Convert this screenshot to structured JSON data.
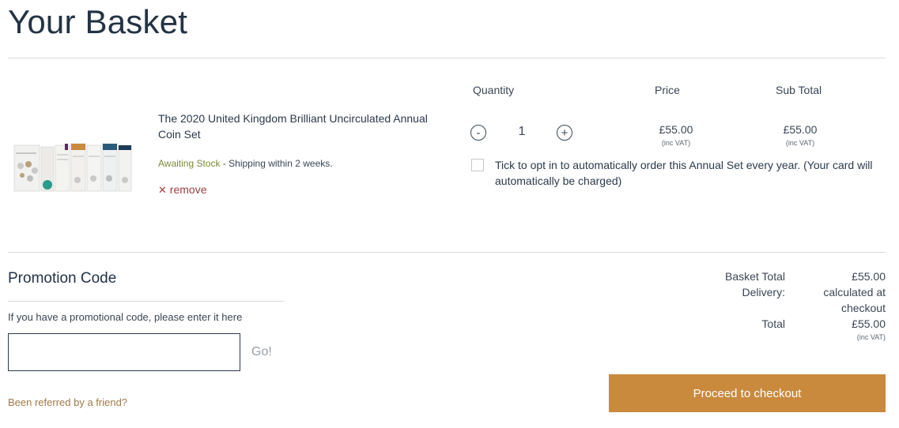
{
  "page": {
    "title": "Your Basket"
  },
  "columns": {
    "quantity": "Quantity",
    "price": "Price",
    "subtotal": "Sub Total"
  },
  "item": {
    "name": "The 2020 United Kingdom Brilliant Uncirculated Annual Coin Set",
    "stock_status": "Awaiting Stock",
    "stock_note": " - Shipping within 2 weeks.",
    "remove_label": "remove",
    "remove_icon": "close-icon",
    "quantity": "1",
    "decrement_label": "-",
    "increment_label": "+",
    "price": "£55.00",
    "price_vat": "(inc VAT)",
    "subtotal": "£55.00",
    "subtotal_vat": "(inc VAT)",
    "optin_text": "Tick to opt in to automatically order this Annual Set every year. (Your card will automatically be charged)",
    "optin_checked": false
  },
  "promo": {
    "title": "Promotion Code",
    "help": "If you have a promotional code, please enter it here",
    "input_value": "",
    "go_label": "Go!",
    "referred_label": "Been referred by a friend?"
  },
  "summary": {
    "basket_total_label": "Basket Total",
    "basket_total_value": "£55.00",
    "delivery_label": "Delivery:",
    "delivery_value_line1": "calculated at",
    "delivery_value_line2": "checkout",
    "total_label": "Total",
    "total_value": "£55.00",
    "total_vat": "(inc VAT)"
  },
  "checkout": {
    "label": "Proceed to checkout"
  },
  "colors": {
    "title": "#233345",
    "checkout_button": "#c98a3e",
    "remove_link": "#9a4040",
    "referred_link": "#a07a4a",
    "stock_status": "#7a8a3a"
  }
}
